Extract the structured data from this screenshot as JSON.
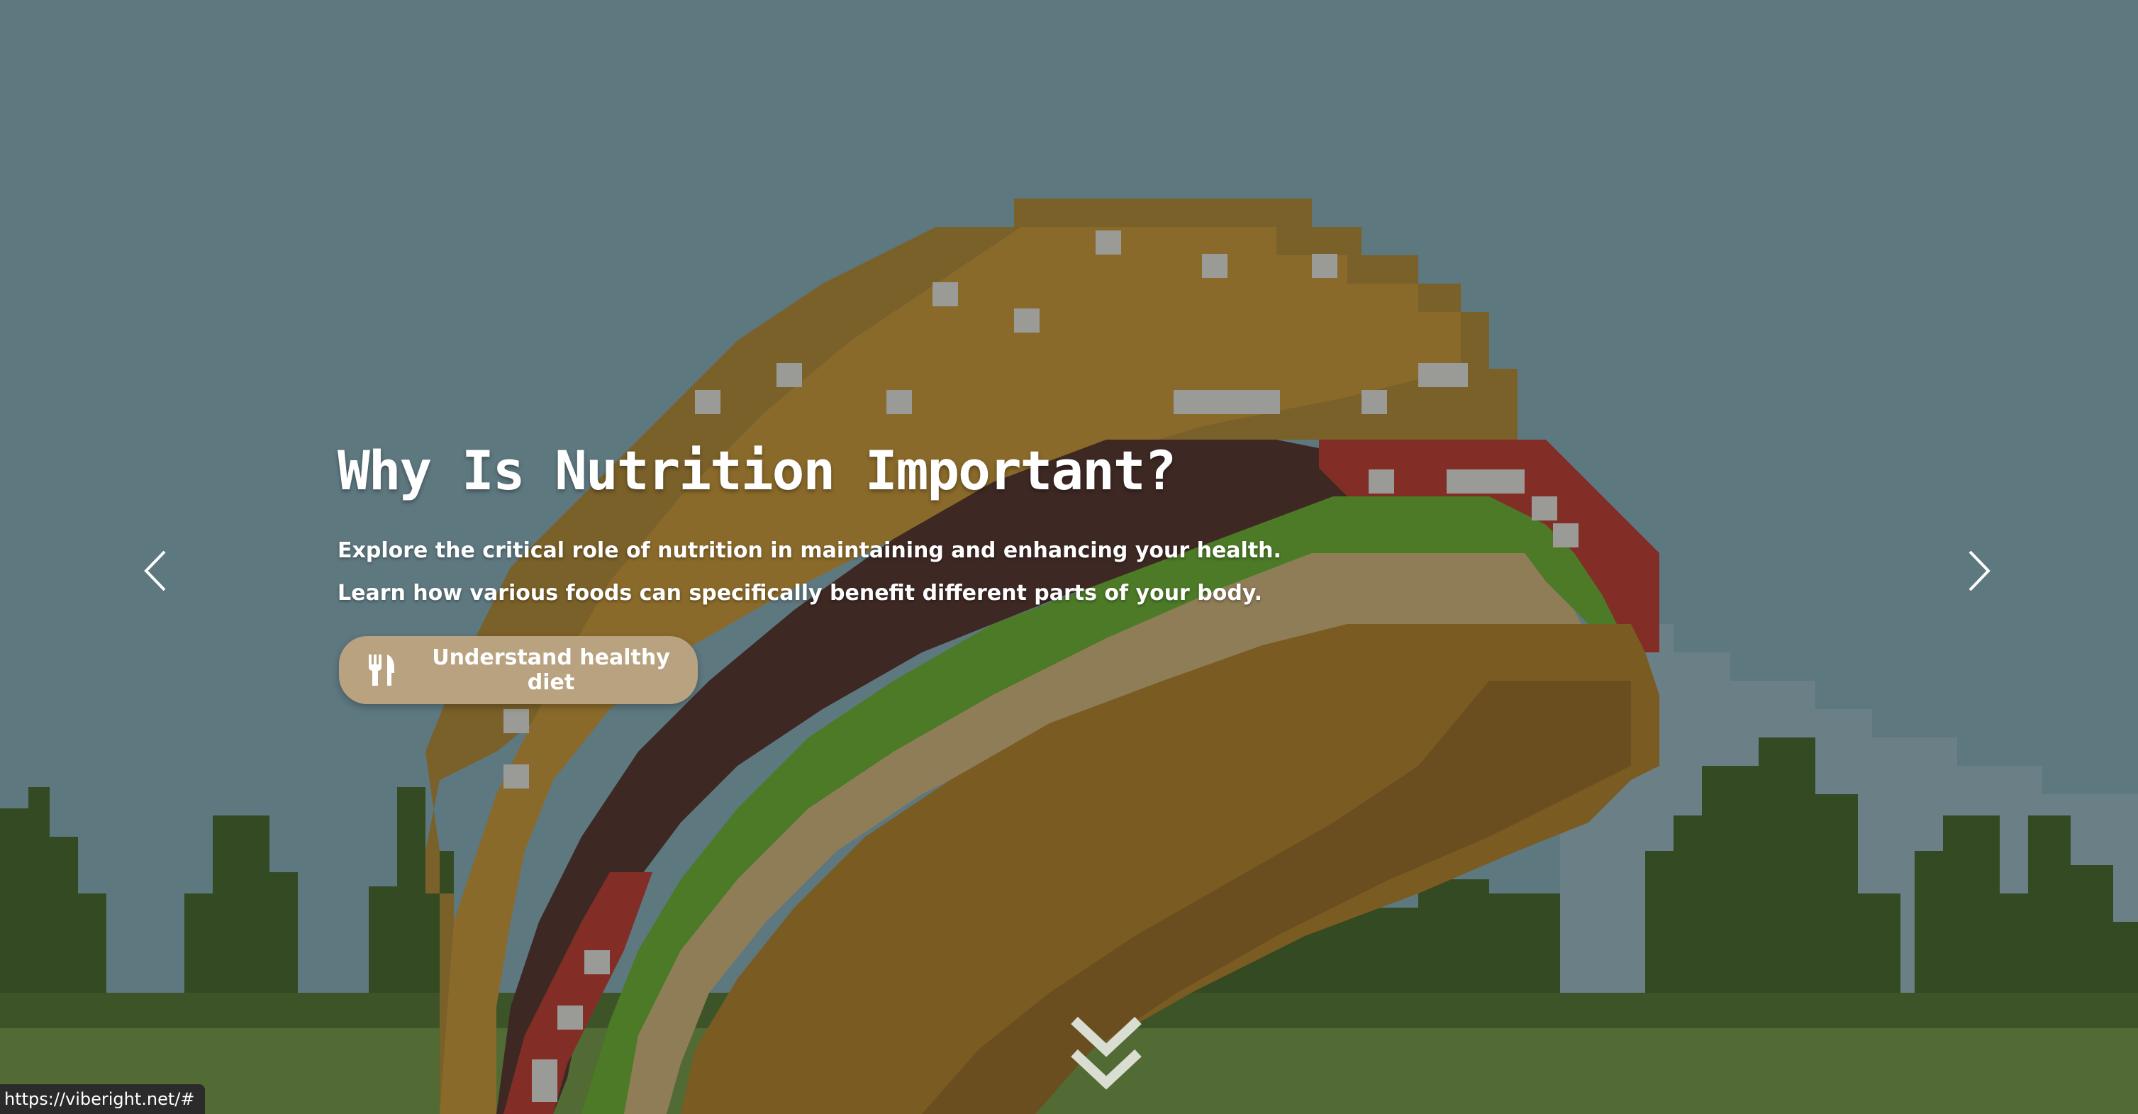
{
  "hero": {
    "title": "Why Is Nutrition Important?",
    "description_line1": "Explore the critical role of nutrition in maintaining and enhancing your health.",
    "description_line2": "Learn how various foods can specifically benefit different parts of your body.",
    "cta_label": "Understand healthy diet",
    "cta_icon": "utensils-icon",
    "prev_icon": "chevron-left-icon",
    "next_icon": "chevron-right-icon",
    "scroll_icon": "double-chevron-down-icon",
    "background_image": "pixel-art-burger-over-pine-forest"
  },
  "status_bar": {
    "url": "https://viberight.net/#"
  },
  "colors": {
    "sky": "#5e7880",
    "cta": "#b9a27f",
    "text": "#ffffff"
  }
}
